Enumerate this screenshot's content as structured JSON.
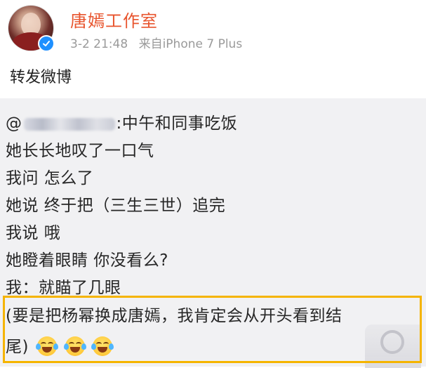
{
  "post": {
    "user_name": "唐嫣工作室",
    "timestamp": "3-2 21:48",
    "source": "来自iPhone 7 Plus",
    "repost_label": "转发微博"
  },
  "quoted": {
    "line1_suffix": ":中午和同事吃饭",
    "line1_prefix": "@",
    "lines": [
      "她长长地叹了一口气",
      "我问 怎么了",
      "她说 终于把（三生三世）追完",
      "我说 哦",
      "她瞪着眼睛 你没看么?",
      "我：就瞄了几眼"
    ],
    "highlight_line1": "(要是把杨幂换成唐嫣，我肯定会从开头看到结",
    "highlight_line2": "尾)"
  },
  "colors": {
    "name": "#e8542d",
    "meta": "#9a9a9a",
    "quote_bg": "#f1f1f3",
    "highlight_border": "#f5b400",
    "verified": "#1e90ff"
  },
  "icons": {
    "verified": "verified-badge-icon",
    "emoji": "laugh-cry-emoji-icon",
    "loading": "loading-spinner-icon"
  }
}
